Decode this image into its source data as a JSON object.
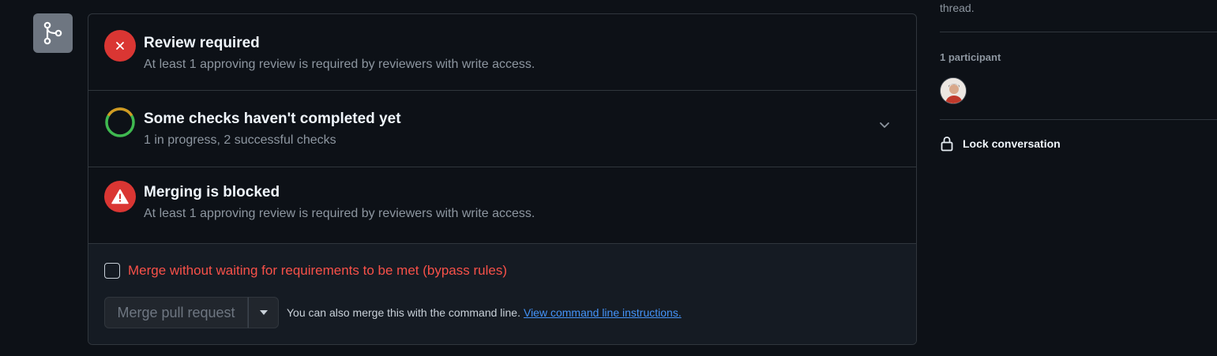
{
  "merge_box": {
    "review": {
      "title": "Review required",
      "subtitle": "At least 1 approving review is required by reviewers with write access.",
      "icon": "x-icon"
    },
    "checks": {
      "title": "Some checks haven't completed yet",
      "subtitle": "1 in progress, 2 successful checks",
      "icon": "progress-ring-icon",
      "progress_fraction": 0.333
    },
    "blocked": {
      "title": "Merging is blocked",
      "subtitle": "At least 1 approving review is required by reviewers with write access.",
      "icon": "alert-triangle-icon"
    },
    "bypass": {
      "label": "Merge without waiting for requirements to be met (bypass rules)",
      "checked": false
    },
    "merge_button": {
      "label": "Merge pull request",
      "disabled": true
    },
    "cli_text": "You can also merge this with the command line.",
    "cli_link": "View command line instructions."
  },
  "sidebar": {
    "thread_text": "thread.",
    "participants_label": "1 participant",
    "lock_label": "Lock conversation"
  },
  "colors": {
    "error": "#da3633",
    "danger_text": "#f85149",
    "link": "#4493f8",
    "success": "#3fb950",
    "pending": "#d29922"
  }
}
